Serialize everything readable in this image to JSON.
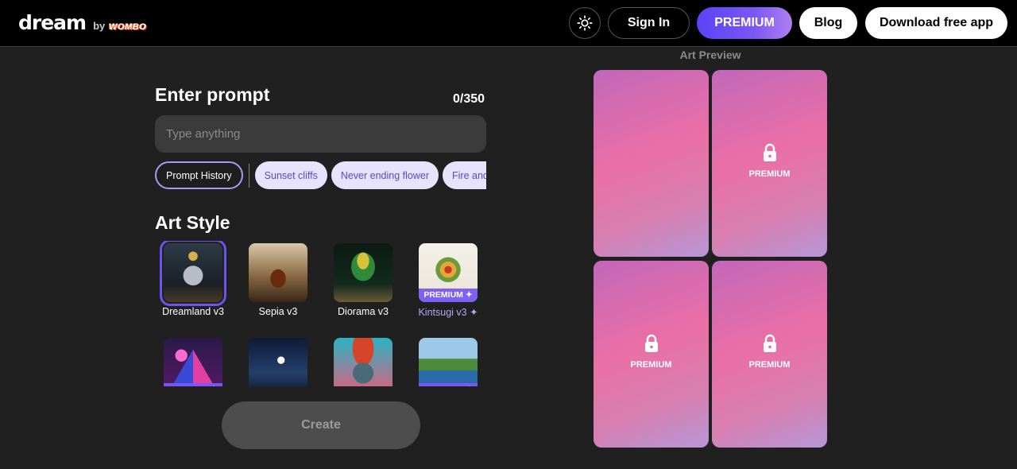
{
  "header": {
    "logo": "dream",
    "logo_by": "by",
    "logo_brand": "WOMBO",
    "theme_icon": "sun-icon",
    "signin_label": "Sign In",
    "premium_label": "PREMIUM",
    "blog_label": "Blog",
    "download_label": "Download free app"
  },
  "prompt": {
    "title": "Enter prompt",
    "counter": "0/350",
    "placeholder": "Type anything",
    "value": ""
  },
  "chips": {
    "history_label": "Prompt History",
    "suggestions": [
      "Sunset cliffs",
      "Never ending flower",
      "Fire and w"
    ]
  },
  "art_style": {
    "title": "Art Style",
    "premium_badge": "PREMIUM ✦",
    "items": [
      {
        "label": "Dreamland v3",
        "selected": true,
        "premium": false
      },
      {
        "label": "Sepia v3",
        "selected": false,
        "premium": false
      },
      {
        "label": "Diorama v3",
        "selected": false,
        "premium": false
      },
      {
        "label": "Kintsugi v3 ✦",
        "selected": false,
        "premium": true
      },
      {
        "label": "",
        "selected": false,
        "premium": true
      },
      {
        "label": "",
        "selected": false,
        "premium": false
      },
      {
        "label": "",
        "selected": false,
        "premium": false
      },
      {
        "label": "",
        "selected": false,
        "premium": true
      }
    ]
  },
  "create_label": "Create",
  "preview": {
    "title": "Art Preview",
    "cards": [
      {
        "locked": false,
        "label": ""
      },
      {
        "locked": true,
        "label": "PREMIUM"
      },
      {
        "locked": true,
        "label": "PREMIUM"
      },
      {
        "locked": true,
        "label": "PREMIUM"
      }
    ]
  },
  "colors": {
    "accent": "#6a54f0",
    "premium_gradient_start": "#5b43f5",
    "premium_gradient_end": "#b07ef0",
    "chip_bg": "#e8e3fd",
    "chip_text": "#5a49c8"
  }
}
